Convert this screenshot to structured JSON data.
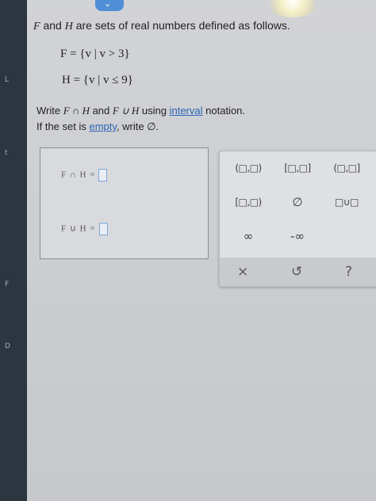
{
  "problem": {
    "intro_f": "F",
    "intro_and": "and",
    "intro_h": "H",
    "intro_rest": "are sets of real numbers defined as follows.",
    "set_f": "F = {v | v > 3}",
    "set_h": "H = {v | v ≤ 9}",
    "instruction_prefix": "Write",
    "instruction_expr1": "F ∩ H",
    "instruction_and": "and",
    "instruction_expr2": "F ∪ H",
    "instruction_using": "using",
    "instruction_link": "interval",
    "instruction_suffix": "notation.",
    "empty_prefix": "If the set is",
    "empty_link": "empty",
    "empty_suffix": ", write ∅."
  },
  "answers": {
    "intersection_label": "F ∩ H =",
    "union_label": "F ∪ H ="
  },
  "palette": {
    "open_open": "(□,□)",
    "closed_closed": "[□,□]",
    "open_closed": "(□,□]",
    "closed_open": "[□,□)",
    "empty_set": "∅",
    "union": "□∪□",
    "infinity": "∞",
    "neg_infinity": "-∞",
    "clear": "×",
    "undo": "↺",
    "help": "?"
  },
  "chrome": {
    "tab_chevron": "⌄",
    "strip_marks": [
      "L",
      "t",
      "F",
      "D"
    ]
  }
}
